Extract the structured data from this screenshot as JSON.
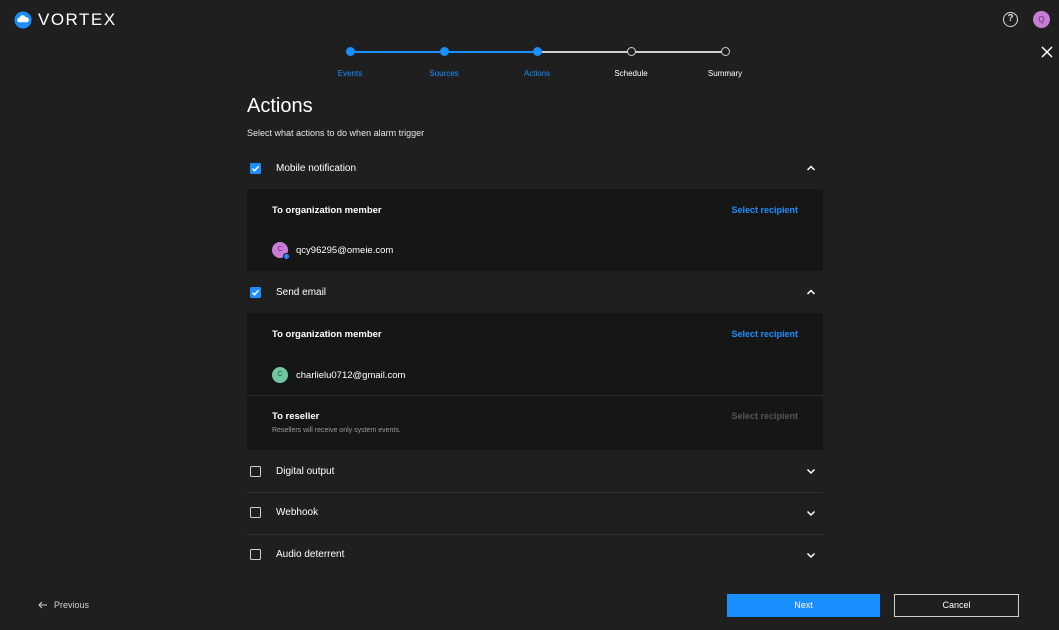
{
  "app": {
    "logo_text": "VORTEX",
    "avatar_initial": "Q"
  },
  "colors": {
    "accent": "#1a8fff",
    "background": "#1f1f1f",
    "panel": "#161616"
  },
  "stepper": {
    "steps": [
      {
        "label": "Events",
        "state": "done"
      },
      {
        "label": "Sources",
        "state": "done"
      },
      {
        "label": "Actions",
        "state": "current"
      },
      {
        "label": "Schedule",
        "state": "todo"
      },
      {
        "label": "Summary",
        "state": "todo"
      }
    ]
  },
  "page": {
    "title": "Actions",
    "subtitle": "Select what actions to do when alarm trigger"
  },
  "sections": {
    "mobile": {
      "label": "Mobile notification",
      "checked": true,
      "expanded": true,
      "group_title": "To organization member",
      "select_label": "Select recipient",
      "recipient_initial": "C",
      "recipient_email": "qcy96295@omeie.com"
    },
    "email": {
      "label": "Send email",
      "checked": true,
      "expanded": true,
      "group_title": "To organization member",
      "select_label": "Select recipient",
      "recipient_initial": "C",
      "recipient_email": "charlielu0712@gmail.com",
      "reseller_title": "To reseller",
      "reseller_note": "Resellers will receive only system events.",
      "reseller_select_label": "Select recipient"
    },
    "digital_output": {
      "label": "Digital output",
      "checked": false,
      "expanded": false
    },
    "webhook": {
      "label": "Webhook",
      "checked": false,
      "expanded": false
    },
    "audio": {
      "label": "Audio deterrent",
      "checked": false,
      "expanded": false
    }
  },
  "footer": {
    "previous_label": "Previous",
    "next_label": "Next",
    "cancel_label": "Cancel"
  }
}
